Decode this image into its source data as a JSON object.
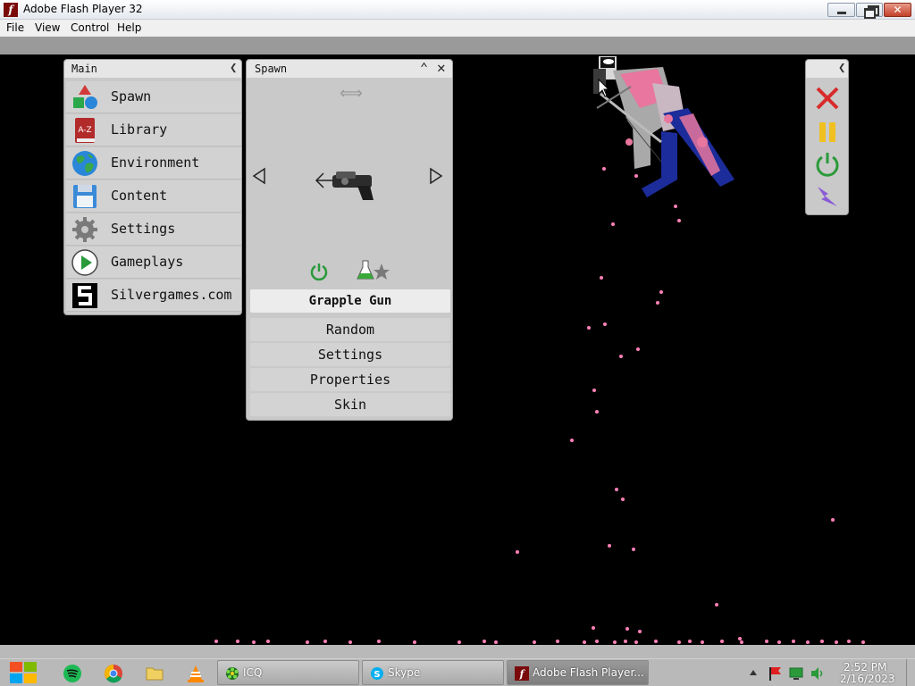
{
  "window": {
    "title": "Adobe Flash Player 32"
  },
  "menu": [
    "File",
    "View",
    "Control",
    "Help"
  ],
  "main_panel": {
    "title": "Main",
    "items": [
      {
        "label": "Spawn",
        "icon": "spawn-shapes-icon"
      },
      {
        "label": "Library",
        "icon": "library-book-icon"
      },
      {
        "label": "Environment",
        "icon": "globe-icon"
      },
      {
        "label": "Content",
        "icon": "floppy-disk-icon"
      },
      {
        "label": "Settings",
        "icon": "gear-icon"
      },
      {
        "label": "Gameplays",
        "icon": "play-icon"
      },
      {
        "label": "Silvergames.com",
        "icon": "silvergames-logo-icon"
      }
    ]
  },
  "library_badge": "A-Z",
  "spawn_panel": {
    "title": "Spawn",
    "selected_item": "Grapple Gun",
    "buttons": [
      "Random",
      "Settings",
      "Properties",
      "Skin"
    ]
  },
  "control_panel": {
    "icons": [
      "close-x-icon",
      "pause-icon",
      "power-icon",
      "lightning-icon"
    ]
  },
  "taskbar": {
    "tasks": [
      {
        "label": "ICQ",
        "active": false
      },
      {
        "label": "Skype",
        "active": false
      },
      {
        "label": "Adobe Flash Player...",
        "active": true
      }
    ],
    "time": "2:52 PM",
    "date": "2/16/2023"
  },
  "colors": {
    "particles": "#ff80b8",
    "ragdoll_pink": "#e8769e",
    "ragdoll_blue": "#1c2c9a",
    "panel_bg": "#c9c9c9"
  }
}
